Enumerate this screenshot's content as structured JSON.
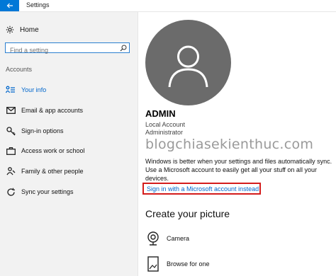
{
  "window": {
    "title": "Settings"
  },
  "sidebar": {
    "home_label": "Home",
    "search_placeholder": "Find a setting",
    "section_title": "Accounts",
    "items": [
      {
        "label": "Your info",
        "icon": "person-list-icon",
        "active": true
      },
      {
        "label": "Email & app accounts",
        "icon": "email-icon"
      },
      {
        "label": "Sign-in options",
        "icon": "key-icon"
      },
      {
        "label": "Access work or school",
        "icon": "briefcase-icon"
      },
      {
        "label": "Family & other people",
        "icon": "people-icon"
      },
      {
        "label": "Sync your settings",
        "icon": "sync-icon"
      }
    ]
  },
  "profile": {
    "name": "ADMIN",
    "account_type": "Local Account",
    "role": "Administrator",
    "watermark": "blogchiasekienthuc.com",
    "info_text": "Windows is better when your settings and files automatically sync. Use a Microsoft account to easily get all your stuff on all your devices.",
    "ms_link": "Sign in with a Microsoft account instead"
  },
  "picture": {
    "heading": "Create your picture",
    "options": [
      {
        "label": "Camera",
        "icon": "camera-icon"
      },
      {
        "label": "Browse for one",
        "icon": "browse-icon"
      }
    ]
  },
  "colors": {
    "accent": "#0078d7",
    "link": "#0066cc",
    "highlight_border": "#d41c1c",
    "avatar_bg": "#6b6b6b"
  }
}
